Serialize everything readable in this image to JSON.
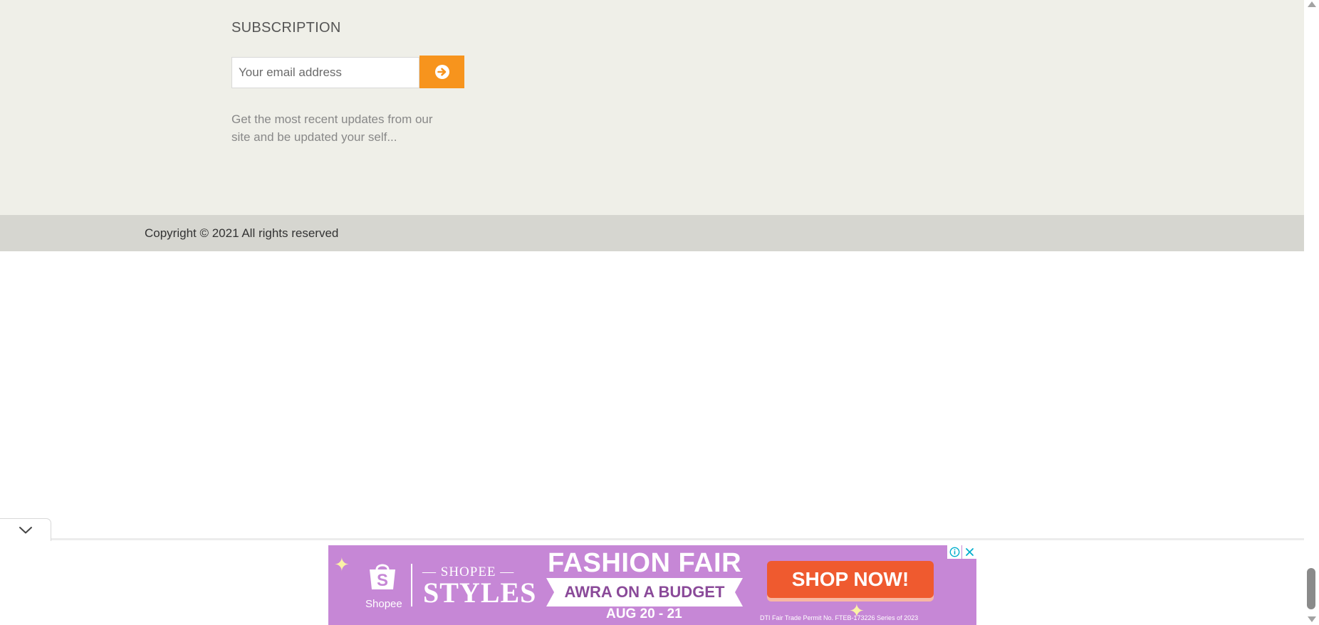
{
  "footer": {
    "subscription_title": "SUBSCRIPTION",
    "email_placeholder": "Your email address",
    "submit_icon": "arrow-circle-right-icon",
    "description": "Get the most recent updates from our site and be updated your self...",
    "accent_color": "#f7941d",
    "background_color": "#efefe8"
  },
  "copyright": {
    "text": "Copyright © 2021 All rights reserved",
    "background_color": "#d6d6d0"
  },
  "ad": {
    "brand": "Shopee",
    "pre_title": "SHOPEE",
    "title": "STYLES",
    "headline": "FASHION FAIR",
    "ribbon": "AWRA ON A BUDGET",
    "date": "AUG 20 - 21",
    "cta": "SHOP NOW!",
    "permit": "DTI Fair Trade Permit No. FTEB-173226 Series of 2023",
    "info_icon": "info-icon",
    "close_icon": "close-icon",
    "background_color": "#c687d6",
    "cta_color": "#ef5a2f"
  },
  "anchor": {
    "collapse_icon": "chevron-down-icon"
  }
}
